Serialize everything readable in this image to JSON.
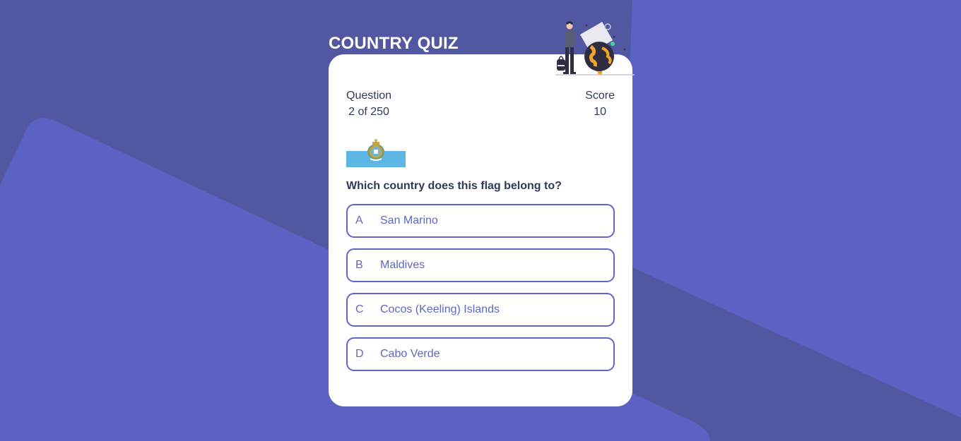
{
  "app": {
    "title": "COUNTRY QUIZ"
  },
  "colors": {
    "background_dark": "#5157a0",
    "background_light": "#5c62c4",
    "accent": "#6066c5",
    "text": "#2e3a59",
    "card": "#ffffff"
  },
  "illustration": {
    "icon": "traveler-with-globe-icon"
  },
  "stats": {
    "question_label": "Question",
    "question_value": "2 of 250",
    "score_label": "Score",
    "score_value": "10"
  },
  "flag": {
    "icon": "san-marino-flag-icon"
  },
  "question": {
    "prompt": "Which country does this flag belong to?"
  },
  "options": [
    {
      "letter": "A",
      "text": "San Marino"
    },
    {
      "letter": "B",
      "text": "Maldives"
    },
    {
      "letter": "C",
      "text": "Cocos (Keeling) Islands"
    },
    {
      "letter": "D",
      "text": "Cabo Verde"
    }
  ]
}
